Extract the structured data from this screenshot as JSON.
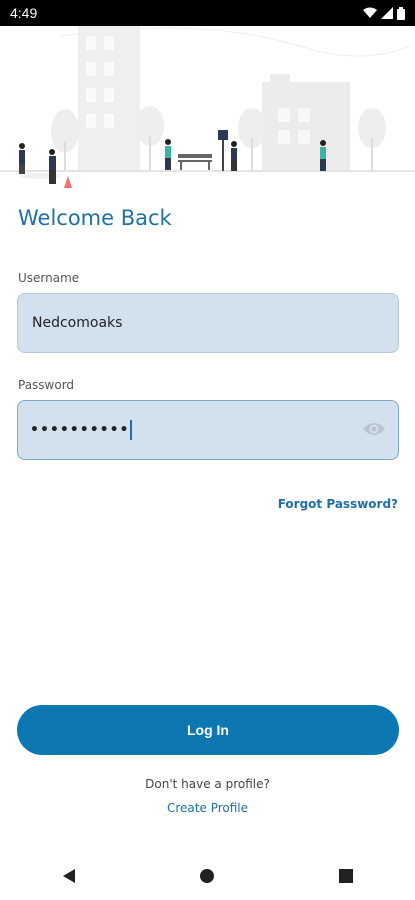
{
  "status": {
    "time": "4:49"
  },
  "title": "Welcome Back",
  "username": {
    "label": "Username",
    "value": "Nedcomoaks"
  },
  "password": {
    "label": "Password",
    "masked": "••••••••••"
  },
  "forgot_label": "Forgot Password?",
  "login_label": "Log In",
  "signup_prompt": "Don't have a profile?",
  "create_label": "Create Profile",
  "colors": {
    "accent": "#0c77b0",
    "title": "#1f6fa8",
    "field_bg": "#d3e1ee"
  },
  "icons": {
    "status": [
      "wifi-icon",
      "signal-icon",
      "battery-icon"
    ],
    "password_toggle": "eye-icon",
    "nav": [
      "back-icon",
      "home-icon",
      "recents-icon"
    ]
  }
}
